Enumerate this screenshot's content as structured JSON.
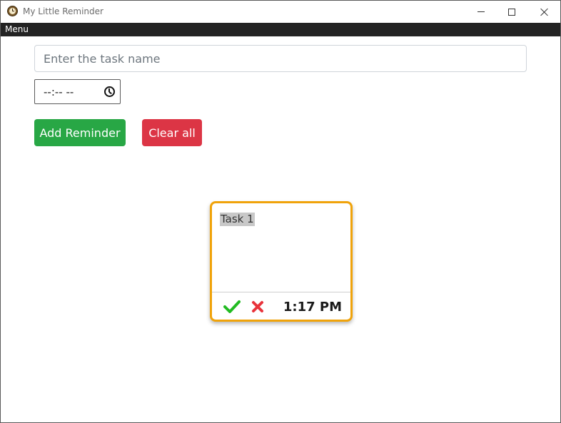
{
  "window": {
    "title": "My Little Reminder"
  },
  "menubar": {
    "items": [
      {
        "label": "Menu"
      }
    ]
  },
  "form": {
    "task_name": {
      "placeholder": "Enter the task name",
      "value": ""
    },
    "time": {
      "value": "--:-- --"
    },
    "add_button_label": "Add Reminder",
    "clear_button_label": "Clear all"
  },
  "reminders": [
    {
      "task": "Task 1",
      "time": "1:17 PM",
      "done_icon": "check-icon",
      "delete_icon": "cross-icon"
    }
  ],
  "colors": {
    "add_button": "#28a745",
    "clear_button": "#dc3545",
    "card_border": "#f0a30a",
    "menubar": "#232323",
    "check": "#22bb22",
    "cross": "#e8333b"
  }
}
